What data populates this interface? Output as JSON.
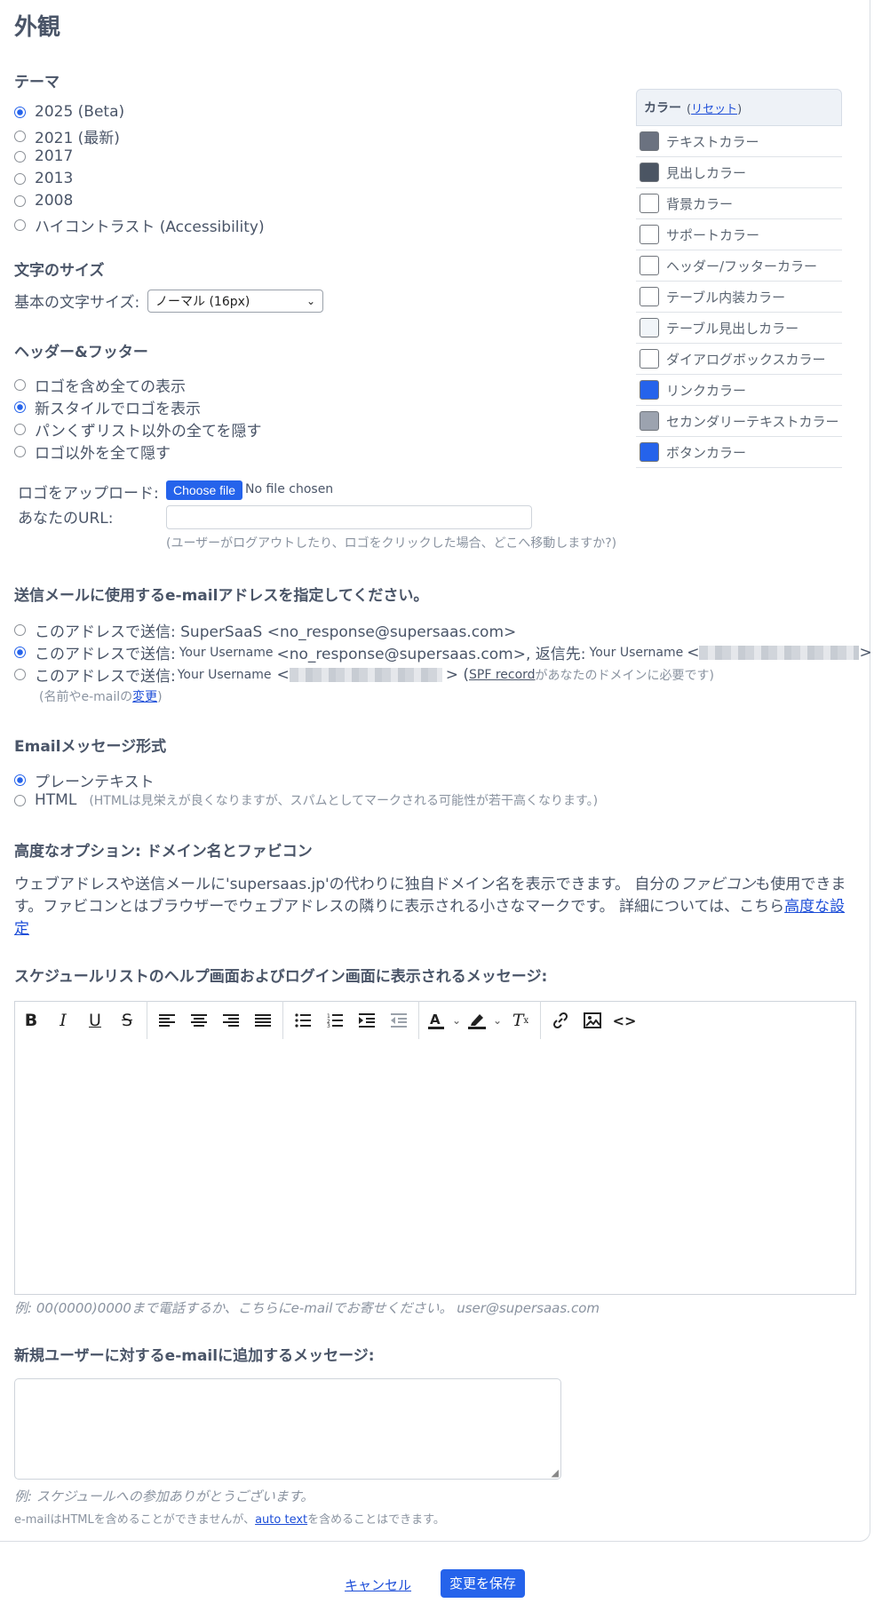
{
  "page_title": "外観",
  "theme": {
    "heading": "テーマ",
    "options": [
      "2025 (Beta)",
      "2021 (最新)",
      "2017",
      "2013",
      "2008",
      "ハイコントラスト (Accessibility)"
    ],
    "selected": 0
  },
  "font_size": {
    "heading": "文字のサイズ",
    "label": "基本の文字サイズ:",
    "value": "ノーマル (16px)"
  },
  "header_footer": {
    "heading": "ヘッダー&フッター",
    "options": [
      "ロゴを含め全ての表示",
      "新スタイルでロゴを表示",
      "パンくずリスト以外の全てを隠す",
      "ロゴ以外を全て隠す"
    ],
    "selected": 1
  },
  "logo": {
    "label": "ロゴをアップロード:",
    "button": "Choose file",
    "status": "No file chosen"
  },
  "url": {
    "label": "あなたのURL:",
    "value": "",
    "hint": "(ユーザーがログアウトしたり、ロゴをクリックした場合、どこへ移動しますか?)"
  },
  "sender": {
    "heading": "送信メールに使用するe-mailアドレスを指定してください。",
    "opt1": "このアドレスで送信: SuperSaaS <no_response@supersaas.com>",
    "opt2_prefix": "このアドレスで送信:",
    "opt2_user": "Your Username",
    "opt2_mid": "<no_response@supersaas.com>, 返信先:",
    "opt2_user2": "Your Username",
    "opt2_lt": "<",
    "opt2_gt": ">",
    "opt3_prefix": "このアドレスで送信:",
    "opt3_user": "Your Username",
    "opt3_lt": "<",
    "opt3_gt": "> (",
    "opt3_link": "SPF record",
    "opt3_suffix": "があなたのドメインに必要です)",
    "note_prefix": "(名前やe-mailの",
    "note_link": "変更",
    "note_suffix": ")",
    "selected": 1
  },
  "email_format": {
    "heading": "Emailメッセージ形式",
    "opt1": "プレーンテキスト",
    "opt2": "HTML",
    "opt2_note": "(HTMLは見栄えが良くなりますが、スパムとしてマークされる可能性が若干高くなります。)",
    "selected": 0
  },
  "advanced": {
    "heading": "高度なオプション: ドメイン名とファビコン",
    "text1": "ウェブアドレスや送信メールに'supersaas.jp'の代わりに独自ドメイン名を表示できます。 自分の",
    "text_italic": "ファビコン",
    "text2": "も使用できます。ファビコンとはブラウザーでウェブアドレスの隣りに表示される小さなマークです。 詳細については、こちら",
    "link": "高度な設定"
  },
  "help_message": {
    "heading": "スケジュールリストのヘルプ画面およびログイン画面に表示されるメッセージ:",
    "example": "例: 00(0000)0000まで電話するか、こちらにe-mailでお寄せください。 user@supersaas.com"
  },
  "new_user_message": {
    "heading": "新規ユーザーに対するe-mailに追加するメッセージ:",
    "example": "例: スケジュールへの参加ありがとうございます。",
    "note_prefix": "e-mailはHTMLを含めることができませんが、",
    "note_link": "auto text",
    "note_suffix": "を含めることはできます。"
  },
  "colors": {
    "heading": "カラー",
    "reset_open": "(",
    "reset": "リセット",
    "reset_close": ")",
    "items": [
      {
        "label": "テキストカラー",
        "color": "#6b7280"
      },
      {
        "label": "見出しカラー",
        "color": "#4b5563"
      },
      {
        "label": "背景カラー",
        "color": "#ffffff"
      },
      {
        "label": "サポートカラー",
        "color": "#ffffff"
      },
      {
        "label": "ヘッダー/フッターカラー",
        "color": "#ffffff"
      },
      {
        "label": "テーブル内装カラー",
        "color": "#ffffff"
      },
      {
        "label": "テーブル見出しカラー",
        "color": "#f1f5f9"
      },
      {
        "label": "ダイアログボックスカラー",
        "color": "#ffffff"
      },
      {
        "label": "リンクカラー",
        "color": "#2563eb"
      },
      {
        "label": "セカンダリーテキストカラー",
        "color": "#9ca3af"
      },
      {
        "label": "ボタンカラー",
        "color": "#2563eb"
      }
    ]
  },
  "actions": {
    "cancel": "キャンセル",
    "save": "変更を保存"
  }
}
